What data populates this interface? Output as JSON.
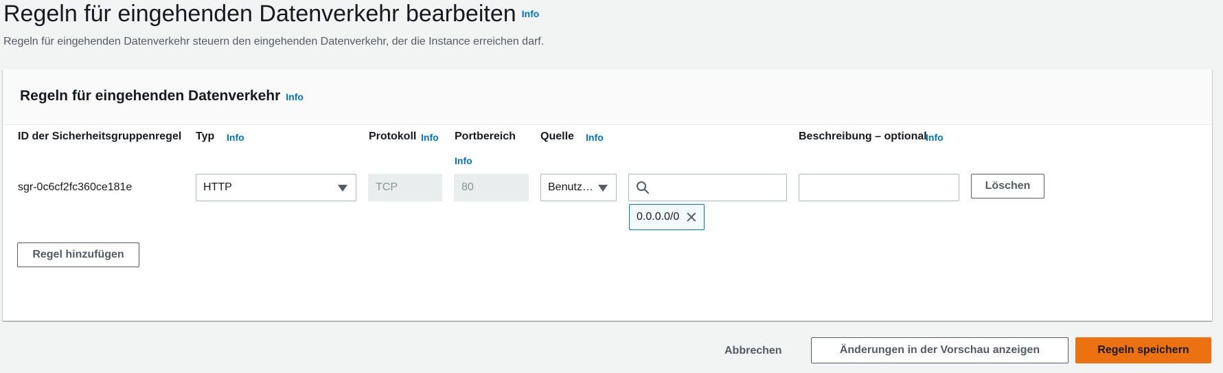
{
  "page": {
    "title": "Regeln für eingehenden Datenverkehr bearbeiten",
    "title_info": "Info",
    "subtitle": "Regeln für eingehenden Datenverkehr steuern den eingehenden Datenverkehr, der die Instance erreichen darf."
  },
  "panel": {
    "title": "Regeln für eingehenden Datenverkehr",
    "title_info": "Info",
    "columns": {
      "rule_id": "ID der Sicherheitsgruppenregel",
      "type": "Typ",
      "type_info": "Info",
      "protocol": "Protokoll",
      "protocol_info": "Info",
      "port_range": "Portbereich",
      "port_range_info": "Info",
      "source": "Quelle",
      "source_info": "Info",
      "description": "Beschreibung – optional",
      "description_info": "Info"
    },
    "rows": [
      {
        "rule_id": "sgr-0c6cf2fc360ce181e",
        "type": "HTTP",
        "protocol": "TCP",
        "port_range": "80",
        "source_type": "Benutz…",
        "source_search_value": "",
        "source_token": "0.0.0.0/0",
        "description_value": "",
        "delete_label": "Löschen"
      }
    ],
    "add_rule_label": "Regel hinzufügen"
  },
  "footer": {
    "cancel_label": "Abbrechen",
    "preview_label": "Änderungen in der Vorschau anzeigen",
    "save_label": "Regeln speichern"
  },
  "colors": {
    "accent": "#ec7211",
    "link": "#0073bb",
    "background": "#f2f3f3"
  }
}
